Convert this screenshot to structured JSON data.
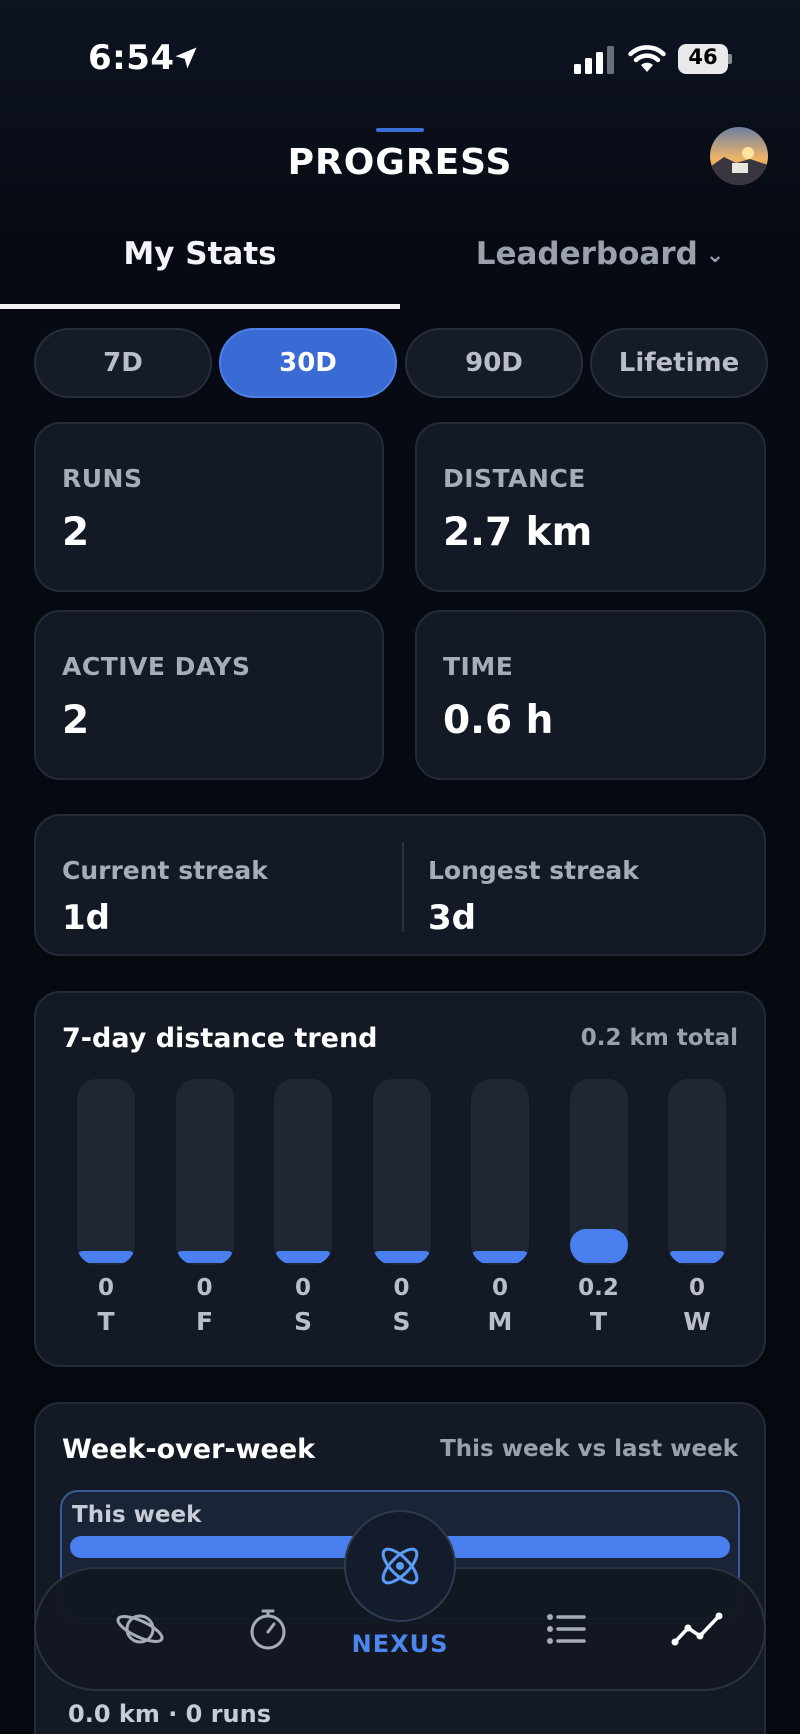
{
  "status_bar": {
    "time": "6:54",
    "battery": "46",
    "icons": [
      "location-arrow-icon",
      "cellular-signal-icon",
      "wifi-icon",
      "battery-icon"
    ]
  },
  "header": {
    "title": "PROGRESS",
    "avatar": "profile-avatar"
  },
  "tabs": [
    {
      "label": "My Stats",
      "active": true
    },
    {
      "label": "Leaderboard",
      "active": false,
      "icon": "chevron-down-icon"
    }
  ],
  "ranges": [
    {
      "label": "7D",
      "active": false
    },
    {
      "label": "30D",
      "active": true
    },
    {
      "label": "90D",
      "active": false
    },
    {
      "label": "Lifetime",
      "active": false
    }
  ],
  "stats": {
    "runs": {
      "label": "RUNS",
      "value": "2"
    },
    "distance": {
      "label": "DISTANCE",
      "value": "2.7 km"
    },
    "active_days": {
      "label": "ACTIVE DAYS",
      "value": "2"
    },
    "time": {
      "label": "TIME",
      "value": "0.6 h"
    }
  },
  "streak": {
    "current_label": "Current streak",
    "current_value": "1d",
    "longest_label": "Longest streak",
    "longest_value": "3d"
  },
  "trend": {
    "title": "7-day distance trend",
    "total": "0.2 km total"
  },
  "chart_data": {
    "type": "bar",
    "categories": [
      "T",
      "F",
      "S",
      "S",
      "M",
      "T",
      "W"
    ],
    "values": [
      0,
      0,
      0,
      0,
      0,
      0.2,
      0
    ],
    "value_labels": [
      "0",
      "0",
      "0",
      "0",
      "0",
      "0.2",
      "0"
    ],
    "title": "7-day distance trend",
    "xlabel": "",
    "ylabel": "",
    "grid": false
  },
  "week_over_week": {
    "title": "Week-over-week",
    "subtitle": "This week vs last week",
    "this_week_label": "This week",
    "summary": "0.0 km · 0 runs"
  },
  "colors": {
    "accent": "#4a7ff0",
    "chip_active": "#3a6ad4",
    "card_bg": "#141a25",
    "background": "#05080f"
  },
  "nav": {
    "center_label": "NEXUS",
    "items": [
      "planet-icon",
      "stopwatch-icon",
      "nexus-atom-icon",
      "list-icon",
      "trend-line-icon"
    ]
  }
}
